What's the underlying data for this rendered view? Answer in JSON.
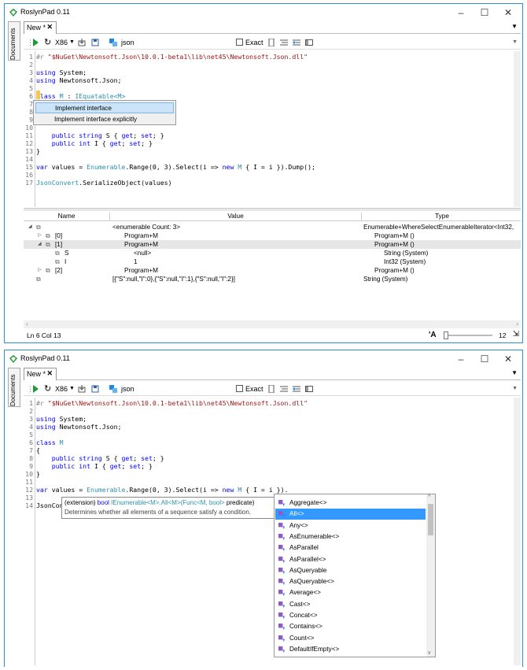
{
  "window1": {
    "title": "RoslynPad 0.11",
    "controls": {
      "minimize": "–",
      "maximize": "☐",
      "close": "✕"
    },
    "side_tab": "Documents",
    "doc_tab": {
      "label": "New *",
      "close": "✕"
    },
    "toolbar": {
      "platform": "X86",
      "target": "json",
      "exact_label": "Exact"
    },
    "code_lines": [
      {
        "n": "1",
        "segments": [
          {
            "c": "pp",
            "t": "#r "
          },
          {
            "c": "st",
            "t": "\"$NuGet\\Newtonsoft.Json\\10.0.1-beta1\\lib\\net45\\Newtonsoft.Json.dll\""
          }
        ]
      },
      {
        "n": "2",
        "segments": []
      },
      {
        "n": "3",
        "segments": [
          {
            "c": "kw",
            "t": "using"
          },
          {
            "c": "",
            "t": " System;"
          }
        ]
      },
      {
        "n": "4",
        "segments": [
          {
            "c": "kw",
            "t": "using"
          },
          {
            "c": "",
            "t": " Newtonsoft.Json;"
          }
        ]
      },
      {
        "n": "5",
        "segments": []
      },
      {
        "n": "6",
        "segments": [
          {
            "c": "kw",
            "t": "class"
          },
          {
            "c": "ty",
            "t": " M"
          },
          {
            "c": "",
            "t": " : "
          },
          {
            "c": "ty",
            "t": "IEquatable<M>"
          }
        ]
      },
      {
        "n": "7",
        "segments": []
      },
      {
        "n": "8",
        "segments": []
      },
      {
        "n": "9",
        "segments": []
      },
      {
        "n": "10",
        "segments": []
      },
      {
        "n": "11",
        "segments": [
          {
            "c": "",
            "t": "    "
          },
          {
            "c": "kw",
            "t": "public string"
          },
          {
            "c": "",
            "t": " S { "
          },
          {
            "c": "kw",
            "t": "get"
          },
          {
            "c": "",
            "t": "; "
          },
          {
            "c": "kw",
            "t": "set"
          },
          {
            "c": "",
            "t": "; }"
          }
        ]
      },
      {
        "n": "12",
        "segments": [
          {
            "c": "",
            "t": "    "
          },
          {
            "c": "kw",
            "t": "public int"
          },
          {
            "c": "",
            "t": " I { "
          },
          {
            "c": "kw",
            "t": "get"
          },
          {
            "c": "",
            "t": "; "
          },
          {
            "c": "kw",
            "t": "set"
          },
          {
            "c": "",
            "t": "; }"
          }
        ]
      },
      {
        "n": "13",
        "segments": [
          {
            "c": "",
            "t": "}"
          }
        ]
      },
      {
        "n": "14",
        "segments": []
      },
      {
        "n": "15",
        "segments": [
          {
            "c": "kw",
            "t": "var"
          },
          {
            "c": "",
            "t": " values = "
          },
          {
            "c": "ty",
            "t": "Enumerable"
          },
          {
            "c": "",
            "t": ".Range(0, 3).Select(i => "
          },
          {
            "c": "kw",
            "t": "new"
          },
          {
            "c": "ty",
            "t": " M"
          },
          {
            "c": "",
            "t": " { I = i }).Dump();"
          }
        ]
      },
      {
        "n": "16",
        "segments": []
      },
      {
        "n": "17",
        "segments": [
          {
            "c": "ty",
            "t": "JsonConvert"
          },
          {
            "c": "",
            "t": ".SerializeObject(values)"
          }
        ]
      }
    ],
    "quick_fix": [
      "Implement interface",
      "Implement interface explicitly"
    ],
    "results": {
      "headers": [
        "Name",
        "Value",
        "Type"
      ],
      "rows": [
        {
          "indent": 0,
          "expander": "◢",
          "name": "",
          "value": "<enumerable Count: 3>",
          "type": "Enumerable+WhereSelectEnumerableIterator<Int32,",
          "selected": false
        },
        {
          "indent": 1,
          "expander": "▷",
          "name": "[0]",
          "value": "Program+M",
          "type": "Program+M ()",
          "selected": false
        },
        {
          "indent": 1,
          "expander": "◢",
          "name": "[1]",
          "value": "Program+M",
          "type": "Program+M ()",
          "selected": true
        },
        {
          "indent": 2,
          "expander": "",
          "name": "S",
          "value": "<null>",
          "type": "String (System)",
          "selected": false
        },
        {
          "indent": 2,
          "expander": "",
          "name": "I",
          "value": "1",
          "type": "Int32 (System)",
          "selected": false
        },
        {
          "indent": 1,
          "expander": "▷",
          "name": "[2]",
          "value": "Program+M",
          "type": "Program+M ()",
          "selected": false
        },
        {
          "indent": 0,
          "expander": "",
          "name": "",
          "value": "[{\"S\":null,\"I\":0},{\"S\":null,\"I\":1},{\"S\":null,\"I\":2}]",
          "type": "String (System)",
          "selected": false
        }
      ]
    },
    "status": {
      "position": "Ln 6 Col 13",
      "font_icon": "'A",
      "font_size": "12"
    }
  },
  "window2": {
    "title": "RoslynPad 0.11",
    "controls": {
      "minimize": "–",
      "maximize": "☐",
      "close": "✕"
    },
    "side_tab": "Documents",
    "doc_tab": {
      "label": "New *",
      "close": "✕"
    },
    "toolbar": {
      "platform": "X86",
      "target": "json",
      "exact_label": "Exact"
    },
    "code_lines": [
      {
        "n": "1",
        "segments": [
          {
            "c": "pp",
            "t": "#r "
          },
          {
            "c": "st",
            "t": "\"$NuGet\\Newtonsoft.Json\\10.0.1-beta1\\lib\\net45\\Newtonsoft.Json.dll\""
          }
        ]
      },
      {
        "n": "2",
        "segments": []
      },
      {
        "n": "3",
        "segments": [
          {
            "c": "kw",
            "t": "using"
          },
          {
            "c": "",
            "t": " System;"
          }
        ]
      },
      {
        "n": "4",
        "segments": [
          {
            "c": "kw",
            "t": "using"
          },
          {
            "c": "",
            "t": " Newtonsoft.Json;"
          }
        ]
      },
      {
        "n": "5",
        "segments": []
      },
      {
        "n": "6",
        "segments": [
          {
            "c": "kw",
            "t": "class"
          },
          {
            "c": "ty",
            "t": " M"
          }
        ]
      },
      {
        "n": "7",
        "segments": [
          {
            "c": "",
            "t": "{"
          }
        ]
      },
      {
        "n": "8",
        "segments": [
          {
            "c": "",
            "t": "    "
          },
          {
            "c": "kw",
            "t": "public string"
          },
          {
            "c": "",
            "t": " S { "
          },
          {
            "c": "kw",
            "t": "get"
          },
          {
            "c": "",
            "t": "; "
          },
          {
            "c": "kw",
            "t": "set"
          },
          {
            "c": "",
            "t": "; }"
          }
        ]
      },
      {
        "n": "9",
        "segments": [
          {
            "c": "",
            "t": "    "
          },
          {
            "c": "kw",
            "t": "public int"
          },
          {
            "c": "",
            "t": " I { "
          },
          {
            "c": "kw",
            "t": "get"
          },
          {
            "c": "",
            "t": "; "
          },
          {
            "c": "kw",
            "t": "set"
          },
          {
            "c": "",
            "t": "; }"
          }
        ]
      },
      {
        "n": "10",
        "segments": [
          {
            "c": "",
            "t": "}"
          }
        ]
      },
      {
        "n": "11",
        "segments": []
      },
      {
        "n": "12",
        "segments": [
          {
            "c": "kw",
            "t": "var"
          },
          {
            "c": "",
            "t": " values = "
          },
          {
            "c": "ty",
            "t": "Enumerable"
          },
          {
            "c": "",
            "t": ".Range(0, 3).Select(i => "
          },
          {
            "c": "kw",
            "t": "new"
          },
          {
            "c": "ty",
            "t": " M"
          },
          {
            "c": "",
            "t": " { I = i })."
          }
        ]
      },
      {
        "n": "13",
        "segments": []
      },
      {
        "n": "14",
        "segments": [
          {
            "c": "",
            "t": "JsonConv"
          }
        ]
      }
    ],
    "tooltip": {
      "line1": [
        "(extension) ",
        "bool",
        " IEnumerable<M>.All<M>(",
        "Func<M, bool>",
        " predicate)"
      ],
      "line2": "Determines whether all elements of a sequence satisfy a condition."
    },
    "completion": [
      "Aggregate<>",
      "All<>",
      "Any<>",
      "AsEnumerable<>",
      "AsParallel",
      "AsParallel<>",
      "AsQueryable",
      "AsQueryable<>",
      "Average<>",
      "Cast<>",
      "Concat<>",
      "Contains<>",
      "Count<>",
      "DefaultIfEmpty<>"
    ],
    "completion_selected": 1
  },
  "colors": {
    "accent": "#2f8fd1",
    "selection": "#3399ff",
    "popup_highlight": "#cce4f7",
    "row_selected": "#e6e6e6",
    "play": "#1a9a32"
  }
}
